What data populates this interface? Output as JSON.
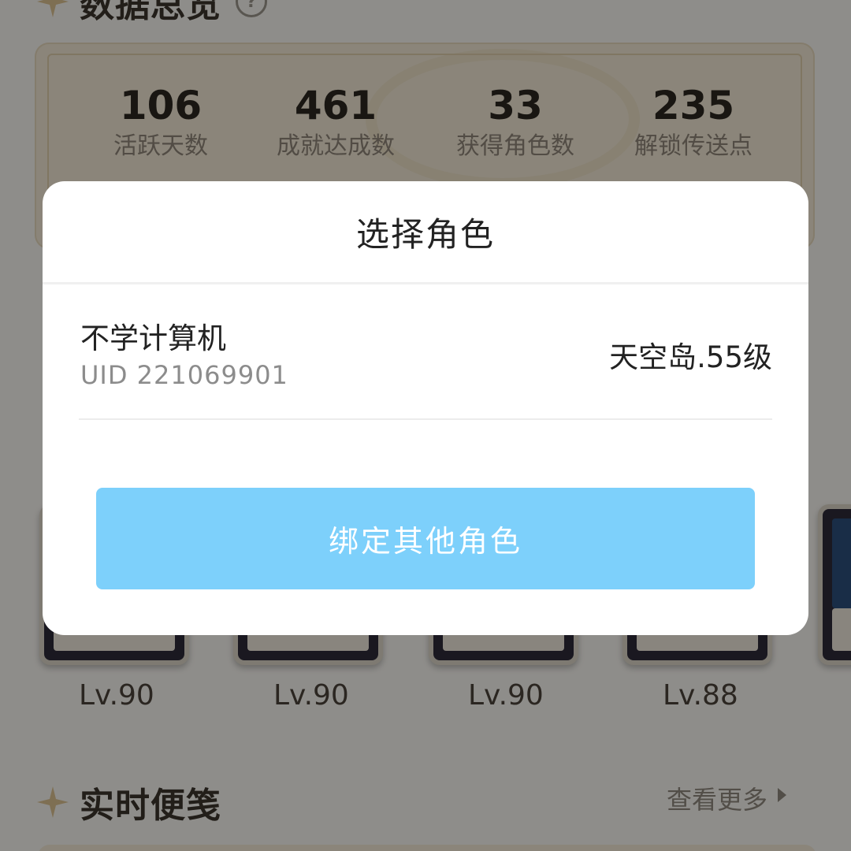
{
  "background": {
    "overview_title": "数据总览",
    "stats": [
      {
        "value": "106",
        "label": "活跃天数"
      },
      {
        "value": "461",
        "label": "成就达成数"
      },
      {
        "value": "33",
        "label": "获得角色数"
      },
      {
        "value": "235",
        "label": "解锁传送点"
      }
    ],
    "characters": [
      {
        "level": "Lv.90",
        "art_color": "#e8663a"
      },
      {
        "level": "Lv.90",
        "art_color": "#b8322f"
      },
      {
        "level": "Lv.90",
        "art_color": "#2f4e9c"
      },
      {
        "level": "Lv.88",
        "art_color": "#3a2a25"
      },
      {
        "level": "",
        "art_color": "#2c4f7a"
      }
    ],
    "notes_title": "实时便笺",
    "view_more": "查看更多"
  },
  "dialog": {
    "title": "选择角色",
    "role": {
      "name": "不学计算机",
      "uid": "UID 221069901",
      "server_level": "天空岛.55级"
    },
    "bind_button": "绑定其他角色"
  },
  "colors": {
    "accent_button": "#7dd0fb",
    "overlay": "rgba(0,0,0,0.42)",
    "card_beige": "#efe6d2"
  },
  "icons": [
    "sparkle-star-icon",
    "help-circle-icon",
    "chevron-right-icon"
  ]
}
